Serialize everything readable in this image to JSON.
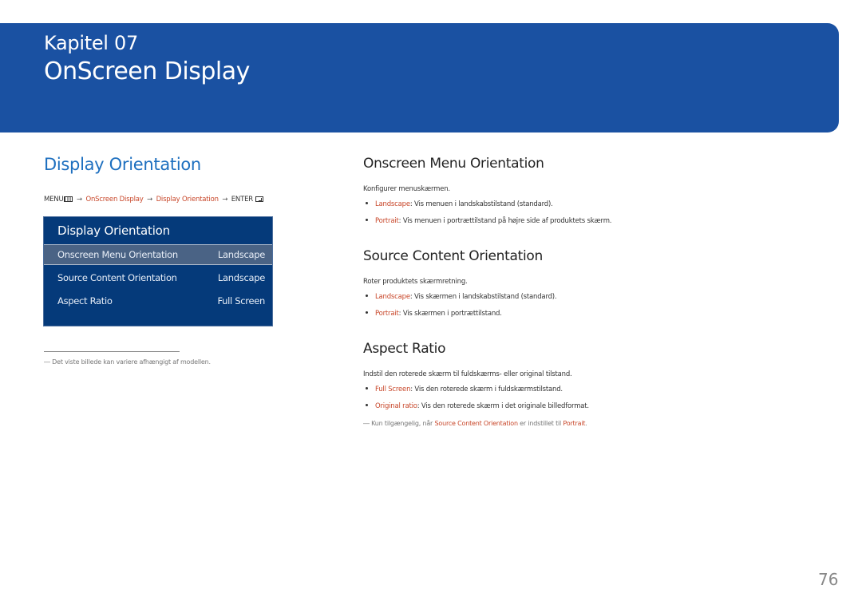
{
  "header": {
    "chapter": "Kapitel 07",
    "title": "OnScreen Display",
    "banner_color": "#1a51a2"
  },
  "left": {
    "section_title": "Display Orientation",
    "breadcrumb": {
      "menu": "MENU",
      "menu_icon": "menu-grid-icon",
      "arrow": "→",
      "step1": "OnScreen Display",
      "step2": "Display Orientation",
      "enter": "ENTER",
      "enter_icon": "enter-icon"
    },
    "osd": {
      "title": "Display Orientation",
      "rows": [
        {
          "label": "Onscreen Menu Orientation",
          "value": "Landscape",
          "selected": true
        },
        {
          "label": "Source Content Orientation",
          "value": "Landscape",
          "selected": false
        },
        {
          "label": "Aspect Ratio",
          "value": "Full Screen",
          "selected": false
        }
      ]
    },
    "footnote": "Det viste billede kan variere afhængigt af modellen.",
    "footnote_mark": "―"
  },
  "right": {
    "sections": [
      {
        "title": "Onscreen Menu Orientation",
        "desc": "Konfigurer menuskærmen.",
        "items": [
          {
            "term": "Landscape",
            "text": ": Vis menuen i landskabstilstand (standard)."
          },
          {
            "term": "Portrait",
            "text": ": Vis menuen i portrættilstand på højre side af produktets skærm."
          }
        ]
      },
      {
        "title": "Source Content Orientation",
        "desc": "Roter produktets skærmretning.",
        "items": [
          {
            "term": "Landscape",
            "text": ": Vis skærmen i landskabstilstand (standard)."
          },
          {
            "term": "Portrait",
            "text": ": Vis skærmen i portrættilstand."
          }
        ]
      },
      {
        "title": "Aspect Ratio",
        "desc": "Indstil den roterede skærm til fuldskærms- eller original tilstand.",
        "items": [
          {
            "term": "Full Screen",
            "text": ": Vis den roterede skærm i fuldskærmstilstand."
          },
          {
            "term": "Original ratio",
            "text": ": Vis den roterede skærm i det originale billedformat."
          }
        ],
        "note": {
          "mark": "―",
          "pre": "Kun tilgængelig, når ",
          "hl1": "Source Content Orientation",
          "mid": " er indstillet til ",
          "hl2": "Portrait",
          "post": "."
        }
      }
    ]
  },
  "page_number": "76",
  "accent_color": "#c8472a"
}
